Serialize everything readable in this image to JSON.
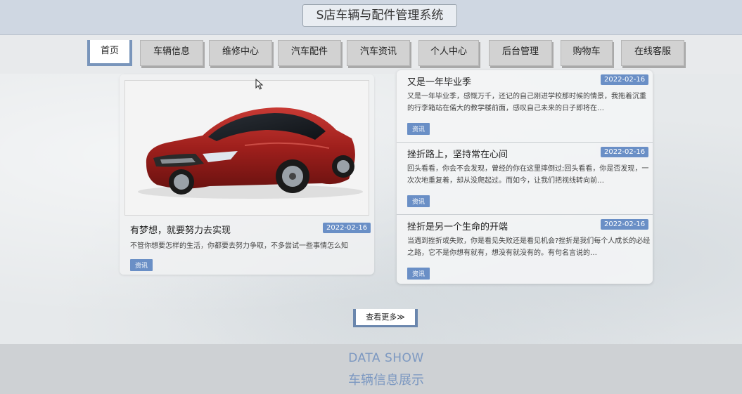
{
  "header": {
    "title": "S店车辆与配件管理系统"
  },
  "nav": [
    "首页",
    "车辆信息",
    "维修中心",
    "汽车配件",
    "汽车资讯",
    "个人中心",
    "后台管理",
    "购物车",
    "在线客服"
  ],
  "featured": {
    "title": "有梦想，就要努力去实现",
    "date": "2022-02-16",
    "text": "不管你想要怎样的生活，你都要去努力争取，不多尝试一些事情怎么知",
    "tag": "资讯"
  },
  "news": [
    {
      "title": "又是一年毕业季",
      "date": "2022-02-16",
      "text": "又是一年毕业季，感慨万千，还记的自己刚进学校那时候的情景，我拖着沉重的行李箱站在偌大的教学楼前面，感叹自己未来的日子即将在…",
      "tag": "资讯"
    },
    {
      "title": "挫折路上，坚持常在心间",
      "date": "2022-02-16",
      "text": "回头看看，你会不会发现，曾经的你在这里摔倒过;回头看看，你是否发现，一次次地重复着，却从没爬起过。而如今，让我们把视线转向前…",
      "tag": "资讯"
    },
    {
      "title": "挫折是另一个生命的开端",
      "date": "2022-02-16",
      "text": "当遇到挫折或失败，你是看见失败还是看见机会?挫折是我们每个人成长的必经之路，它不是你想有就有，想没有就没有的。有句名言说的…",
      "tag": "资讯"
    }
  ],
  "more_button": "查看更多≫",
  "data_show": {
    "title": "DATA SHOW",
    "subtitle": "车辆信息展示"
  },
  "colors": {
    "accent": "#6a8fc6",
    "nav_active_border": "#7995bb",
    "title_blue": "#7c98c1"
  },
  "icons": {
    "cursor": "mouse-pointer-icon"
  }
}
